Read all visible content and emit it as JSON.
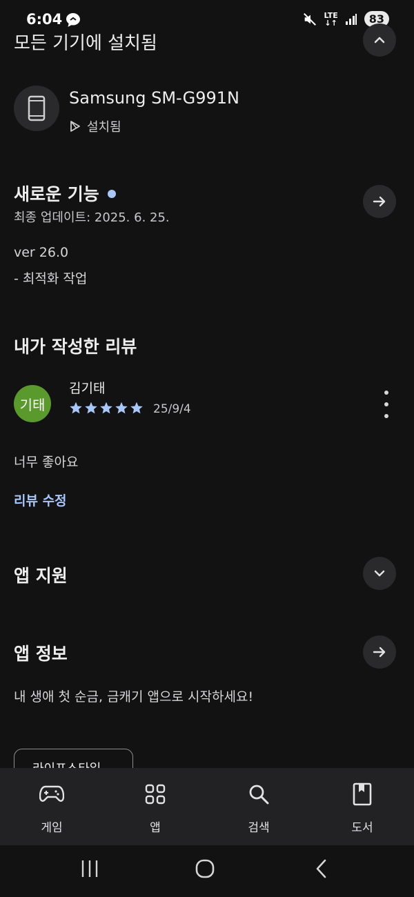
{
  "status_bar": {
    "time": "6:04",
    "network": "LTE",
    "battery": "83"
  },
  "installed_section": {
    "title": "모든 기기에 설치됨",
    "device_name": "Samsung SM-G991N",
    "device_status": "설치됨"
  },
  "whats_new": {
    "title": "새로운 기능",
    "updated": "최종 업데이트: 2025. 6. 25.",
    "version": "ver 26.0",
    "notes": "- 최적화 작업"
  },
  "my_review": {
    "title": "내가 작성한 리뷰",
    "avatar_text": "기태",
    "reviewer": "김기태",
    "rating": 5,
    "date": "25/9/4",
    "text": "너무 좋아요",
    "edit_label": "리뷰 수정"
  },
  "app_support": {
    "title": "앱 지원"
  },
  "app_info": {
    "title": "앱 정보",
    "description": "내 생애 첫 순금, 금캐기 앱으로 시작하세요!",
    "category_chip": "라이프스타일"
  },
  "bottom_nav": [
    {
      "label": "게임",
      "icon": "gamepad-icon"
    },
    {
      "label": "앱",
      "icon": "apps-grid-icon"
    },
    {
      "label": "검색",
      "icon": "search-icon"
    },
    {
      "label": "도서",
      "icon": "book-icon"
    }
  ],
  "colors": {
    "background": "#121212",
    "accent": "#a8c7fa",
    "avatar": "#5a9a2c",
    "nav_background": "#222225"
  }
}
